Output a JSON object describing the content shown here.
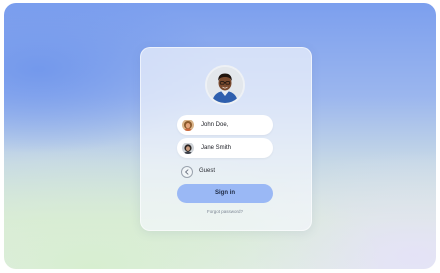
{
  "users": [
    {
      "name": "John Doe,",
      "avatar": "person-avatar-male-curly-hair"
    },
    {
      "name": "Jane Smith",
      "avatar": "person-avatar-female-dark-hair"
    }
  ],
  "guest": {
    "label": "Guest",
    "icon": "arrow-left-circle-icon"
  },
  "signin": {
    "label": "Sign in"
  },
  "forgot": {
    "label": "Forgot password?"
  },
  "colors": {
    "accent": "#9ab8f5",
    "background_top": "#7c9fee",
    "background_bottom": "#dcebdc",
    "card": "#f4f6fc"
  }
}
